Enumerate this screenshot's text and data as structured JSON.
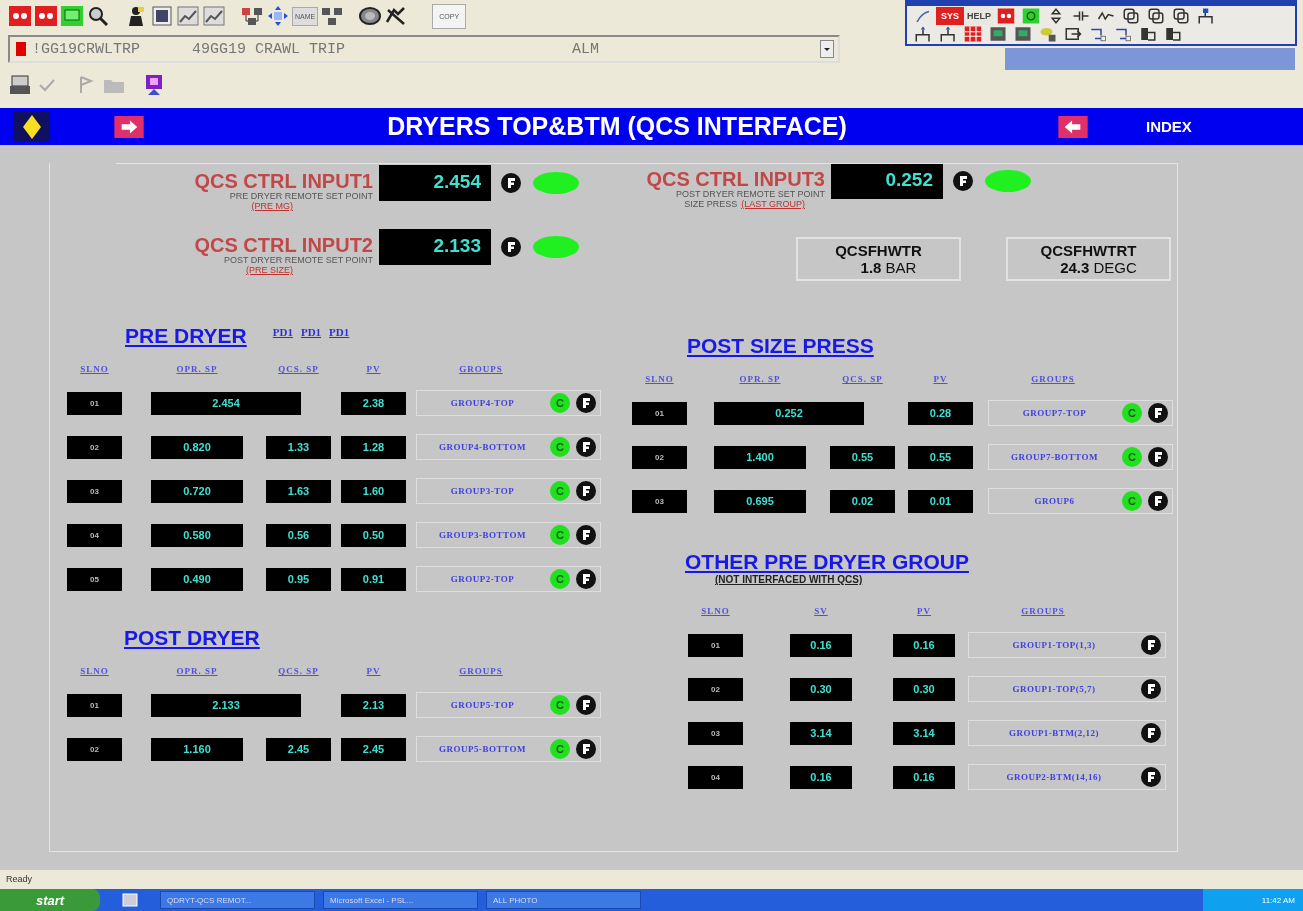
{
  "toolbar": {
    "name_label": "NAME",
    "copy_label": "COPY"
  },
  "alarm_line": {
    "tag": "!GG19CRWLTRP",
    "description": "49GG19 CRAWL TRIP",
    "state": "ALM"
  },
  "palette": {
    "sys_label": "SYS",
    "help_label": "HELP"
  },
  "title_bar": {
    "title": "DRYERS TOP&BTM (QCS INTERFACE)",
    "index_label": "INDEX"
  },
  "qcs_inputs": [
    {
      "title": "QCS CTRL INPUT1",
      "subtitle": "PRE DRYER REMOTE SET POINT",
      "link": "(PRE MG)",
      "value": "2.454"
    },
    {
      "title": "QCS CTRL INPUT2",
      "subtitle": "POST DRYER REMOTE SET POINT",
      "link": "(PRE SIZE)",
      "value": "2.133"
    },
    {
      "title": "QCS CTRL INPUT3",
      "subtitle": "POST DRYER REMOTE SET POINT",
      "prefix": "SIZE PRESS",
      "link": "(LAST GROUP)",
      "value": "0.252"
    }
  ],
  "readings": [
    {
      "tag": "QCSFHWTR",
      "value": "1.8",
      "unit": "BAR"
    },
    {
      "tag": "QCSFHWTRT",
      "value": "24.3",
      "unit": "DEGC"
    }
  ],
  "pre_dryer": {
    "title": "PRE DRYER",
    "links": [
      "PD1",
      "PD1",
      "PD1"
    ],
    "columns": [
      "SLNO",
      "OPR. SP",
      "QCS. SP",
      "PV",
      "GROUPS"
    ],
    "rows": [
      {
        "slno": "01",
        "opr_sp": "2.454",
        "pv": "2.38",
        "group": "GROUP4-TOP",
        "c_label": "C"
      },
      {
        "slno": "02",
        "opr_sp": "0.820",
        "qcs_sp": "1.33",
        "pv": "1.28",
        "group": "GROUP4-BOTTOM",
        "c_label": "C"
      },
      {
        "slno": "03",
        "opr_sp": "0.720",
        "qcs_sp": "1.63",
        "pv": "1.60",
        "group": "GROUP3-TOP",
        "c_label": "C"
      },
      {
        "slno": "04",
        "opr_sp": "0.580",
        "qcs_sp": "0.56",
        "pv": "0.50",
        "group": "GROUP3-BOTTOM",
        "c_label": "C"
      },
      {
        "slno": "05",
        "opr_sp": "0.490",
        "qcs_sp": "0.95",
        "pv": "0.91",
        "group": "GROUP2-TOP",
        "c_label": "C"
      }
    ]
  },
  "post_dryer": {
    "title": "POST DRYER",
    "columns": [
      "SLNO",
      "OPR. SP",
      "QCS. SP",
      "PV",
      "GROUPS"
    ],
    "rows": [
      {
        "slno": "01",
        "opr_sp": "2.133",
        "pv": "2.13",
        "group": "GROUP5-TOP",
        "c_label": "C"
      },
      {
        "slno": "02",
        "opr_sp": "1.160",
        "qcs_sp": "2.45",
        "pv": "2.45",
        "group": "GROUP5-BOTTOM",
        "c_label": "C"
      }
    ]
  },
  "post_size_press": {
    "title": "POST SIZE PRESS",
    "columns": [
      "SLNO",
      "OPR. SP",
      "QCS. SP",
      "PV",
      "GROUPS"
    ],
    "rows": [
      {
        "slno": "01",
        "opr_sp": "0.252",
        "pv": "0.28",
        "group": "GROUP7-TOP",
        "c_label": "C"
      },
      {
        "slno": "02",
        "opr_sp": "1.400",
        "qcs_sp": "0.55",
        "pv": "0.55",
        "group": "GROUP7-BOTTOM",
        "c_label": "C"
      },
      {
        "slno": "03",
        "opr_sp": "0.695",
        "qcs_sp": "0.02",
        "pv": "0.01",
        "group": "GROUP6",
        "c_label": "C"
      }
    ]
  },
  "other_pre_dryer_group": {
    "title": "OTHER PRE DRYER GROUP",
    "note": "(NOT INTERFACED WITH QCS)",
    "columns": [
      "SLNO",
      "SV",
      "PV",
      "GROUPS"
    ],
    "rows": [
      {
        "slno": "01",
        "sv": "0.16",
        "pv": "0.16",
        "group": "GROUP1-TOP(1,3)"
      },
      {
        "slno": "02",
        "sv": "0.30",
        "pv": "0.30",
        "group": "GROUP1-TOP(5,7)"
      },
      {
        "slno": "03",
        "sv": "3.14",
        "pv": "3.14",
        "group": "GROUP1-BTM(2,12)"
      },
      {
        "slno": "04",
        "sv": "0.16",
        "pv": "0.16",
        "group": "GROUP2-BTM(14,16)"
      }
    ]
  },
  "status_bar": {
    "text": "Ready"
  },
  "taskbar": {
    "start": "start",
    "items": [
      "QDRYT-QCS REMOT...",
      "Microsoft Excel - PSL...",
      "ALL PHOTO"
    ],
    "clock": "11:42 AM"
  }
}
